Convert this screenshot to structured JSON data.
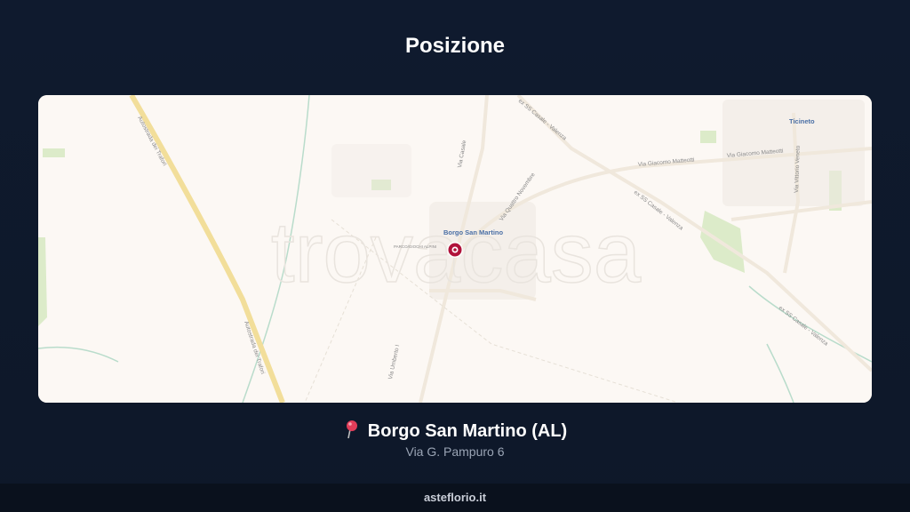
{
  "page_title": "Posizione",
  "map": {
    "watermark": "trovacasa",
    "town_label": "Borgo San Martino",
    "nearby_town_label": "Ticineto",
    "park_label": "PARCO/GIOCHI ALPINI",
    "road_labels": {
      "autostrada_north": "Autostrada dei Trafori",
      "autostrada_south": "Autostrada dei Trafori",
      "ex_ss_casale_north": "ex SS Casale - Valenza",
      "ex_ss_casale_mid": "ex SS Casale - Valenza",
      "ex_ss_casale_east": "ex SS Casale - Valenza",
      "via_casale": "Via Casale",
      "via_giacomo_matteotti_1": "Via Giacomo Matteotti",
      "via_giacomo_matteotti_2": "Via Giacomo Matteotti",
      "via_quattro_novembre": "Via Quattro Novembre",
      "via_vittorio_veneto": "Via Vittorio Veneto",
      "via_umberto": "Via Umberto I"
    },
    "marker_icon": "map-marker-icon",
    "colors": {
      "background": "#fcf8f4",
      "motorway": "#f2de9a",
      "water": "#b9dccb",
      "green": "#dcebc9",
      "marker": "#b0123a"
    }
  },
  "location": {
    "pin_icon": "pushpin-icon",
    "name": "Borgo San Martino (AL)",
    "address": "Via G. Pampuro 6"
  },
  "footer": {
    "site": "asteflorio.it"
  }
}
